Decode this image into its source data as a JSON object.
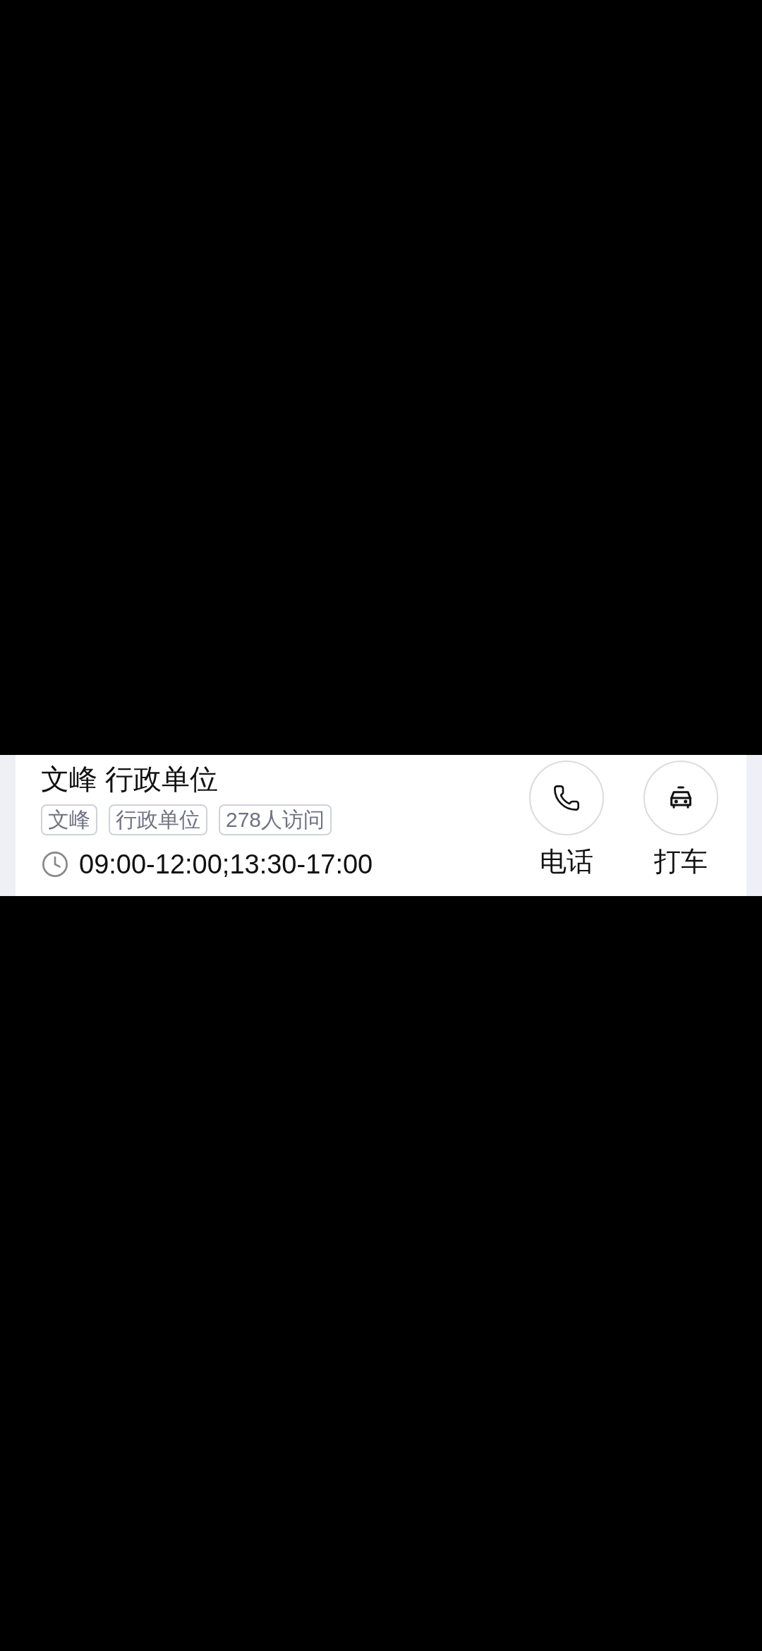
{
  "place": {
    "title": "文峰 行政单位",
    "tags": [
      "文峰",
      "行政单位",
      "278人访问"
    ],
    "hours": "09:00-12:00;13:30-17:00"
  },
  "actions": [
    {
      "kind": "phone",
      "label": "电话"
    },
    {
      "kind": "taxi",
      "label": "打车"
    }
  ]
}
